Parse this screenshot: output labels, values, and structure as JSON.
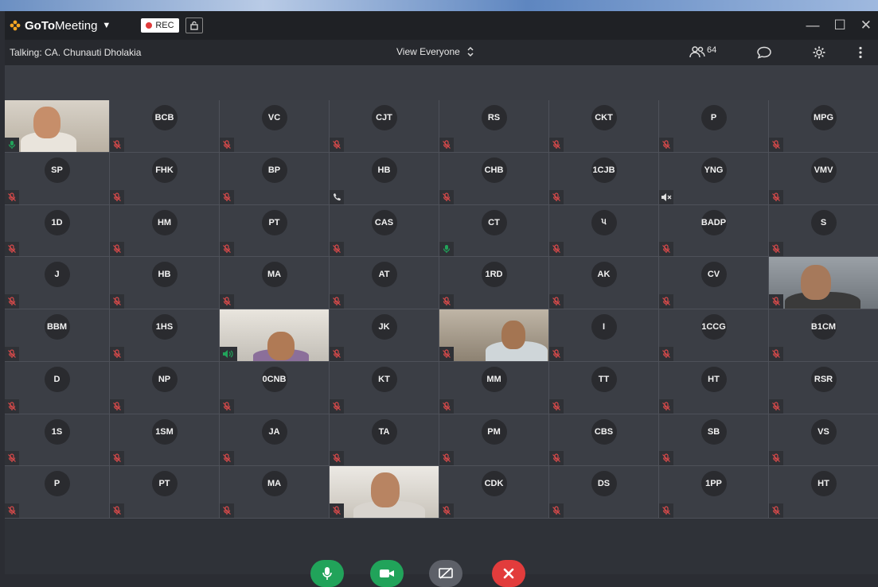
{
  "app": {
    "name_bold": "GoTo",
    "name_rest": "Meeting",
    "rec_label": "REC"
  },
  "window_controls": {
    "minimize": "—",
    "maximize": "☐",
    "close": "✕"
  },
  "infobar": {
    "talking": "Talking: CA. Chunauti Dholakia",
    "view": "View Everyone",
    "participants_count": "64"
  },
  "tiles": [
    {
      "label": "",
      "status": "mic-on",
      "video": "v1"
    },
    {
      "label": "BCB",
      "status": "muted"
    },
    {
      "label": "VC",
      "status": "muted"
    },
    {
      "label": "CJT",
      "status": "muted"
    },
    {
      "label": "RS",
      "status": "muted"
    },
    {
      "label": "CKT",
      "status": "muted"
    },
    {
      "label": "P",
      "status": "muted"
    },
    {
      "label": "MPG",
      "status": "muted"
    },
    {
      "label": "SP",
      "status": "muted"
    },
    {
      "label": "FHK",
      "status": "muted"
    },
    {
      "label": "BP",
      "status": "muted"
    },
    {
      "label": "HB",
      "status": "phone"
    },
    {
      "label": "CHB",
      "status": "muted"
    },
    {
      "label": "1CJB",
      "status": "muted"
    },
    {
      "label": "YNG",
      "status": "speaker-off"
    },
    {
      "label": "VMV",
      "status": "muted"
    },
    {
      "label": "1D",
      "status": "muted"
    },
    {
      "label": "HM",
      "status": "muted"
    },
    {
      "label": "PT",
      "status": "muted"
    },
    {
      "label": "CAS",
      "status": "muted"
    },
    {
      "label": "CT",
      "status": "mic-on"
    },
    {
      "label": "પ",
      "status": "muted"
    },
    {
      "label": "BADP",
      "status": "muted"
    },
    {
      "label": "S",
      "status": "muted"
    },
    {
      "label": "J",
      "status": "muted"
    },
    {
      "label": "HB",
      "status": "muted"
    },
    {
      "label": "MA",
      "status": "muted"
    },
    {
      "label": "AT",
      "status": "muted"
    },
    {
      "label": "1RD",
      "status": "muted"
    },
    {
      "label": "AK",
      "status": "muted"
    },
    {
      "label": "CV",
      "status": "muted"
    },
    {
      "label": "",
      "status": "muted",
      "video": "v2"
    },
    {
      "label": "BBM",
      "status": "muted"
    },
    {
      "label": "1HS",
      "status": "muted"
    },
    {
      "label": "",
      "status": "speaking",
      "video": "v3"
    },
    {
      "label": "JK",
      "status": "muted"
    },
    {
      "label": "",
      "status": "muted",
      "video": "v4"
    },
    {
      "label": "I",
      "status": "muted"
    },
    {
      "label": "1CCG",
      "status": "muted"
    },
    {
      "label": "B1CM",
      "status": "muted"
    },
    {
      "label": "D",
      "status": "muted"
    },
    {
      "label": "NP",
      "status": "muted"
    },
    {
      "label": "0CNB",
      "status": "muted"
    },
    {
      "label": "KT",
      "status": "muted"
    },
    {
      "label": "MM",
      "status": "muted"
    },
    {
      "label": "TT",
      "status": "muted"
    },
    {
      "label": "HT",
      "status": "muted"
    },
    {
      "label": "RSR",
      "status": "muted"
    },
    {
      "label": "1S",
      "status": "muted"
    },
    {
      "label": "1SM",
      "status": "muted"
    },
    {
      "label": "JA",
      "status": "muted"
    },
    {
      "label": "TA",
      "status": "muted"
    },
    {
      "label": "PM",
      "status": "muted"
    },
    {
      "label": "CBS",
      "status": "muted"
    },
    {
      "label": "SB",
      "status": "muted"
    },
    {
      "label": "VS",
      "status": "muted"
    },
    {
      "label": "P",
      "status": "muted"
    },
    {
      "label": "PT",
      "status": "muted"
    },
    {
      "label": "MA",
      "status": "muted"
    },
    {
      "label": "",
      "status": "muted",
      "video": "v5"
    },
    {
      "label": "CDK",
      "status": "muted"
    },
    {
      "label": "DS",
      "status": "muted"
    },
    {
      "label": "1PP",
      "status": "muted"
    },
    {
      "label": "HT",
      "status": "muted"
    }
  ],
  "controls": {
    "mic": "mic-icon",
    "camera": "camera-icon",
    "share": "screen-share-off-icon",
    "end": "close-icon"
  },
  "colors": {
    "green": "#21a35a",
    "red": "#e23c3c",
    "muted_red": "#d84a4a"
  }
}
